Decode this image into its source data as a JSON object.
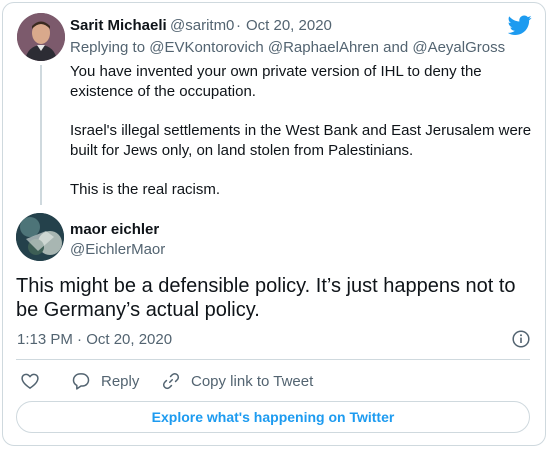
{
  "quoted_tweet": {
    "author_name": "Sarit Michaeli",
    "handle": "@saritm0",
    "separator": "·",
    "date": "Oct 20, 2020",
    "replying_prefix": "Replying to",
    "mentions": [
      "@EVKontorovich",
      "@RaphaelAhren",
      "and",
      "@AeyalGross"
    ],
    "paragraphs": [
      "You have invented your own private version of IHL to  deny the existence of the occupation.",
      "Israel's illegal settlements in the West Bank and East Jerusalem were built for Jews only, on land stolen from Palestinians.",
      "This is the real racism."
    ]
  },
  "main_tweet": {
    "author_name": "maor eichler",
    "handle": "@EichlerMaor",
    "text": "This might be a defensible policy. It’s just happens not to be Germany’s actual policy.",
    "timestamp": "1:13 PM · Oct 20, 2020"
  },
  "actions": {
    "like_icon": "heart-icon",
    "reply_label": "Reply",
    "reply_icon": "speech-bubble-icon",
    "copy_link_label": "Copy link to Tweet",
    "copy_link_icon": "link-icon"
  },
  "explore_label": "Explore what's happening on Twitter",
  "colors": {
    "brand": "#1d9bf0",
    "text": "#0f1419",
    "secondary": "#536471",
    "border": "#cfd9de"
  }
}
